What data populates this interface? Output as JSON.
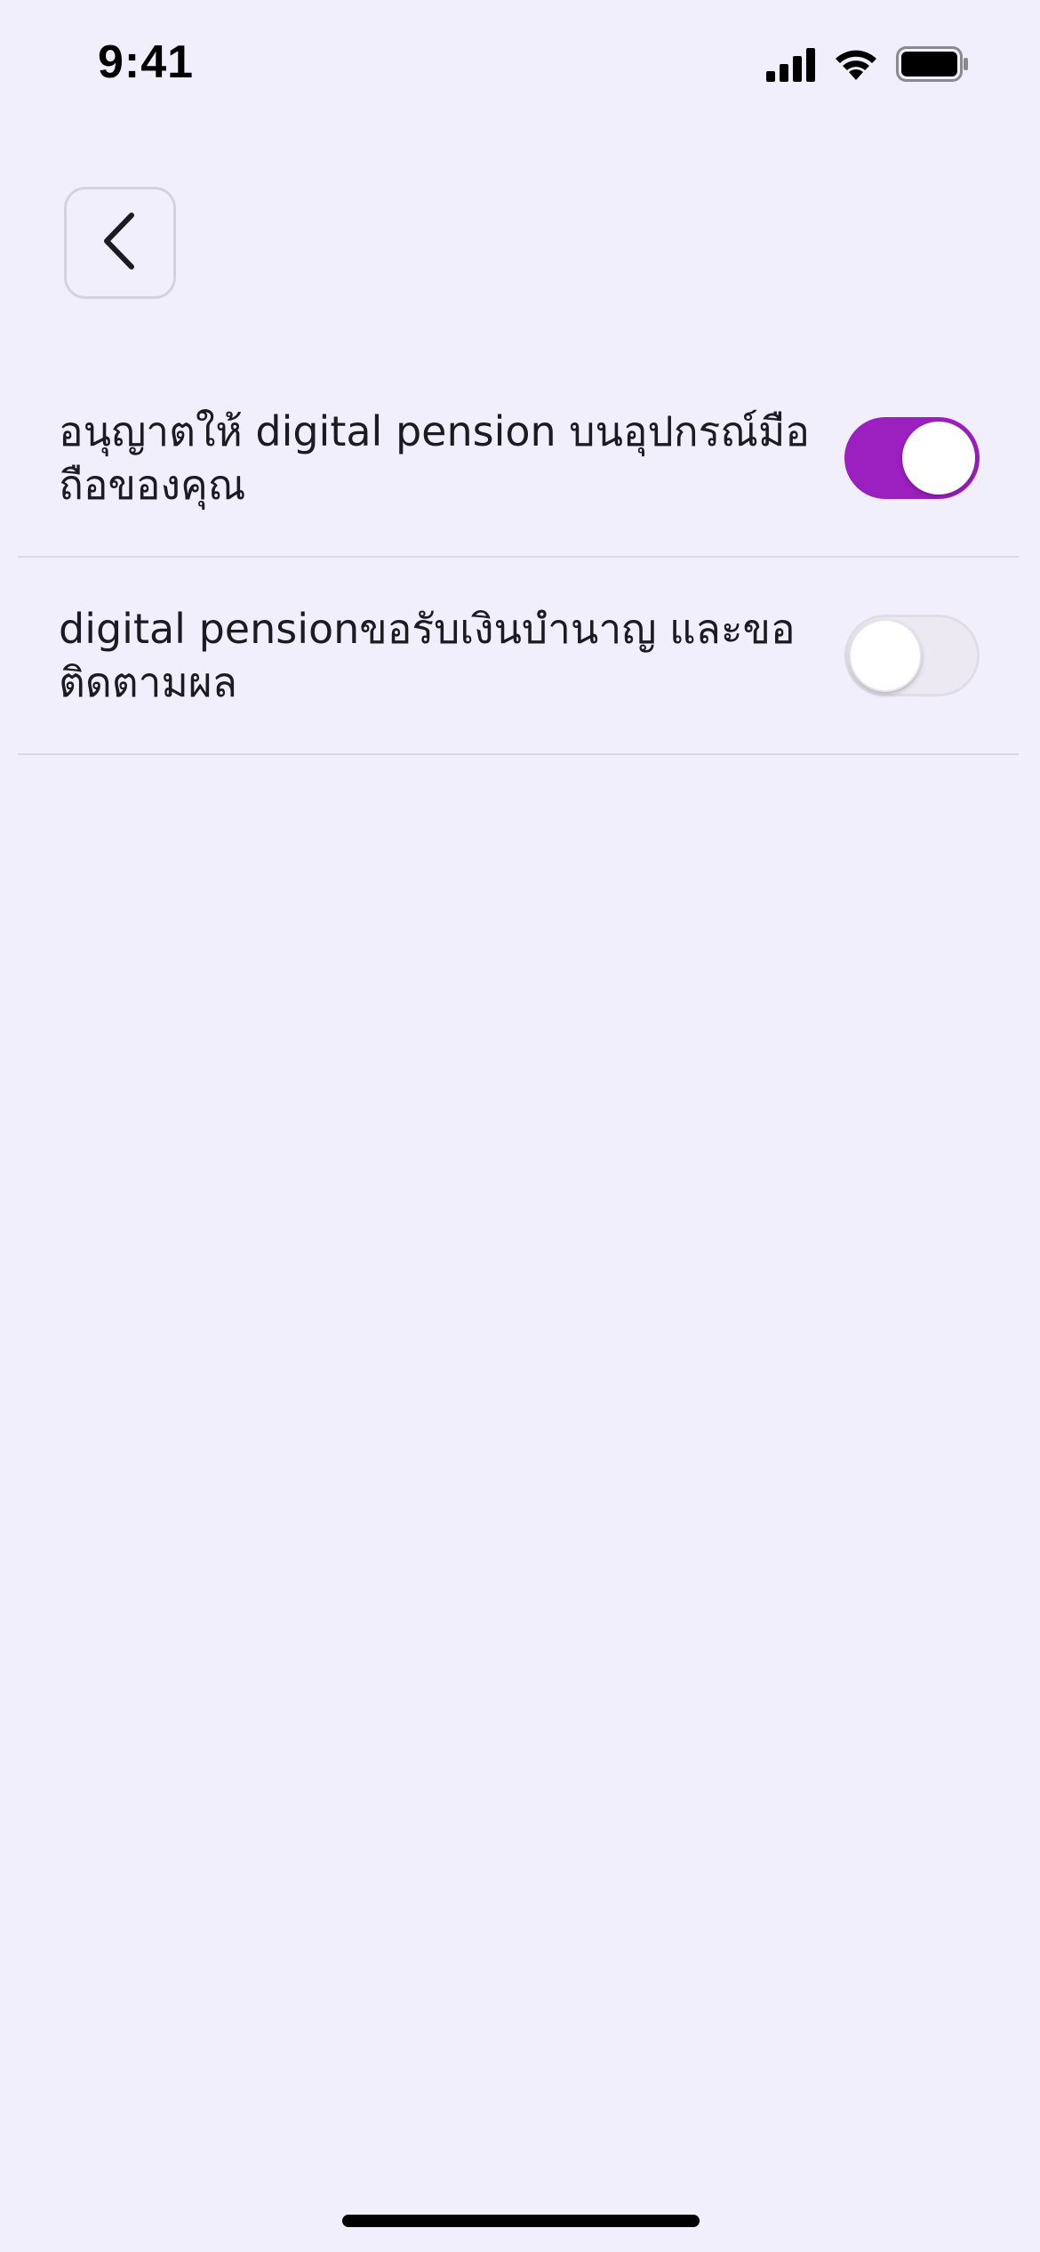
{
  "status_bar": {
    "time": "9:41",
    "icons": [
      "cellular-signal-icon",
      "wifi-icon",
      "battery-icon"
    ]
  },
  "nav": {
    "back_icon": "chevron-left-icon"
  },
  "settings": [
    {
      "label": "อนุญาตให้ digital pension บนอุปกรณ์มือถือของคุณ",
      "enabled": true
    },
    {
      "label": "digital pensionขอรับเงินบำนาญ และขอติดตามผล",
      "enabled": false
    }
  ],
  "colors": {
    "background": "#F2EFFC",
    "accent": "#9C1FBF",
    "divider": "#DCD9E3",
    "text": "#1C1B21"
  }
}
